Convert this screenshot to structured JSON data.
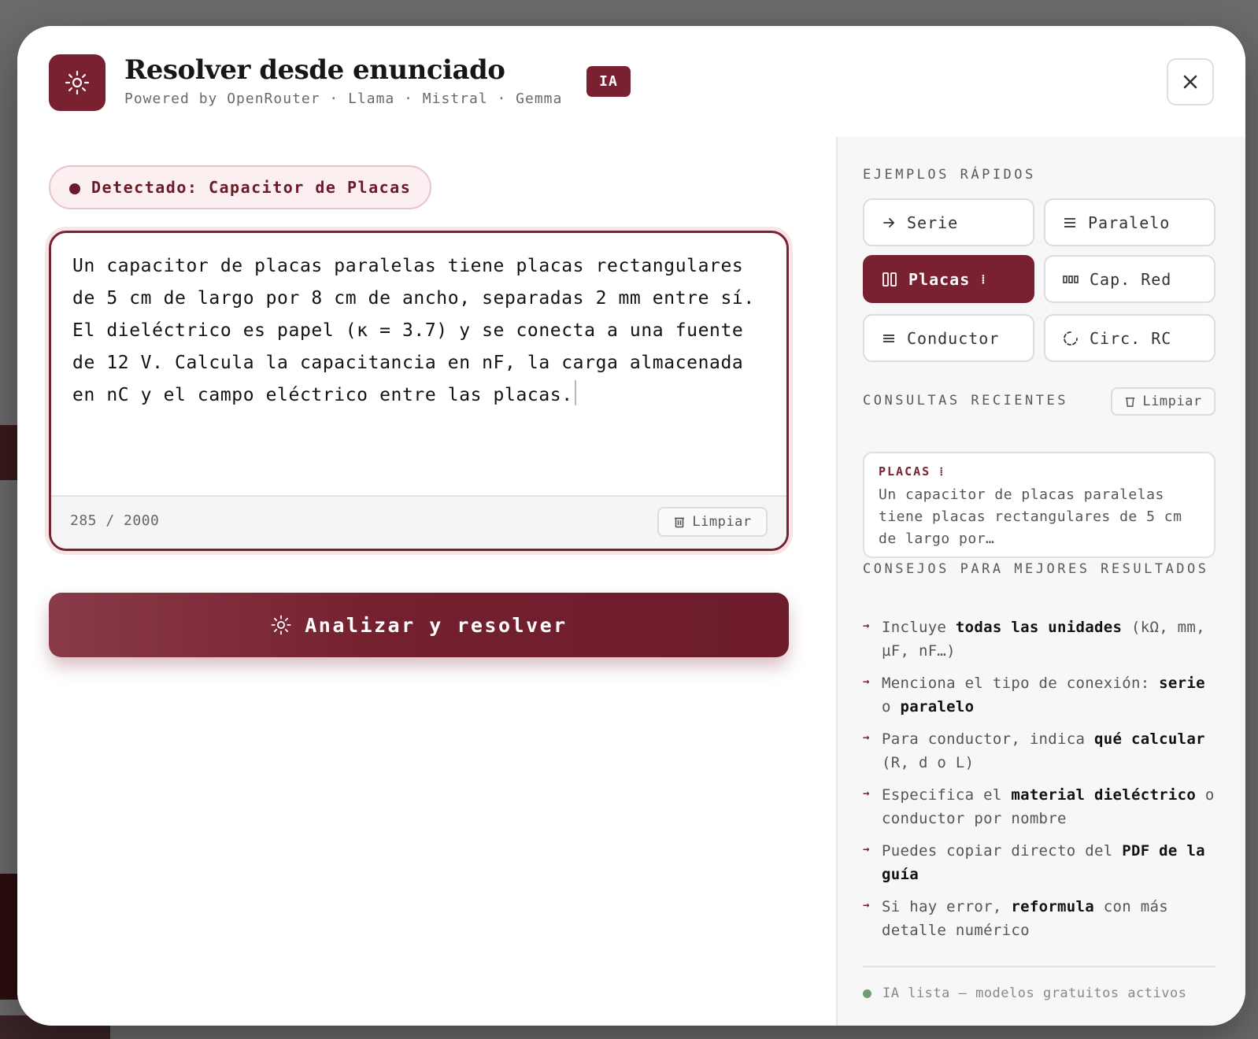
{
  "header": {
    "title": "Resolver desde enunciado",
    "subtitle": "Powered by OpenRouter · Llama · Mistral · Gemma",
    "badge": "IA",
    "icons": {
      "app": "sun-icon",
      "close": "close-icon"
    }
  },
  "detected": {
    "label": "Detectado: Capacitor de Placas"
  },
  "editor": {
    "text": "Un capacitor de placas paralelas tiene placas rectangulares de 5 cm de largo por 8 cm de ancho, separadas 2 mm entre sí. El dieléctrico es papel (κ = 3.7) y se conecta a una fuente de 12 V. Calcula la capacitancia en nF, la carga almacenada en nC y el campo eléctrico entre las placas.",
    "char_count": "285 / 2000",
    "clear_label": "Limpiar"
  },
  "analyze_button": {
    "label": "Analizar y resolver"
  },
  "sidebar": {
    "examples_title": "EJEMPLOS RÁPIDOS",
    "examples": [
      {
        "label": "Serie",
        "icon": "arrow-right-icon",
        "active": false
      },
      {
        "label": "Paralelo",
        "icon": "parallel-lines-icon",
        "active": false
      },
      {
        "label": "Placas",
        "icon": "plates-icon",
        "active": true,
        "suffix": "⁞"
      },
      {
        "label": "Cap. Red",
        "icon": "capacitor-network-icon",
        "active": false
      },
      {
        "label": "Conductor",
        "icon": "conductor-icon",
        "active": false
      },
      {
        "label": "Circ. RC",
        "icon": "rc-circuit-icon",
        "active": false
      }
    ],
    "recent_title": "CONSULTAS RECIENTES",
    "recent_clear_label": "Limpiar",
    "recent": [
      {
        "tag": "PLACAS ⁞",
        "text": "Un capacitor de placas paralelas tiene placas rectangulares de 5 cm de largo por…"
      }
    ],
    "tips_title": "CONSEJOS PARA MEJORES RESULTADOS",
    "tips": [
      [
        "Incluye ",
        "todas las unidades",
        " (kΩ, mm, µF, nF…)"
      ],
      [
        "Menciona el tipo de conexión: ",
        "serie",
        " o ",
        "paralelo"
      ],
      [
        "Para conductor, indica ",
        "qué calcular",
        " (R, d o L)"
      ],
      [
        "Especifica el ",
        "material dieléctrico",
        " o conductor por nombre"
      ],
      [
        "Puedes copiar directo del ",
        "PDF de la guía"
      ],
      [
        "Si hay error, ",
        "reformula",
        " con más detalle numérico"
      ]
    ],
    "status": "IA lista — modelos gratuitos activos"
  },
  "colors": {
    "accent": "#7a2131",
    "accent_soft": "#fbeff1",
    "status_ok": "#6f9b73"
  }
}
